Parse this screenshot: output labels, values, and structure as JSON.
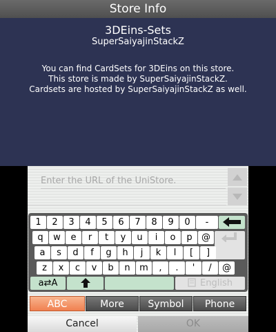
{
  "top": {
    "title": "Store Info",
    "store_name": "3DEins-Sets",
    "store_author": "SuperSaiyajinStackZ",
    "description": [
      "You can find CardSets for 3DEins on this store.",
      "This store is made by SuperSaiyajinStackZ.",
      "Cardsets are hosted by SuperSaiyajinStackZ as well."
    ]
  },
  "url_field": {
    "placeholder": "Enter the URL of the UniStore.",
    "value": ""
  },
  "keyboard": {
    "row1": [
      "1",
      "2",
      "3",
      "4",
      "5",
      "6",
      "7",
      "8",
      "9",
      "0",
      "-"
    ],
    "row2": [
      "q",
      "w",
      "e",
      "r",
      "t",
      "y",
      "u",
      "i",
      "o",
      "p",
      "@"
    ],
    "row3": [
      "a",
      "s",
      "d",
      "f",
      "g",
      "h",
      "j",
      "k",
      "l",
      "[",
      "]"
    ],
    "row4": [
      "z",
      "x",
      "c",
      "v",
      "b",
      "n",
      "m",
      ",",
      ".",
      "'",
      "/",
      "@"
    ],
    "backspace_icon": "left-arrow-icon",
    "enter_icon": "enter-arrow-icon",
    "shift_label": "a⇄A",
    "shift_up_icon": "up-arrow-icon",
    "language_label": "English",
    "language_icon": "document-icon"
  },
  "mode_tabs": {
    "abc": "ABC",
    "more": "More",
    "symbol": "Symbol",
    "phone": "Phone",
    "active": "ABC",
    "active_color": "#f08050"
  },
  "buttons": {
    "cancel": "Cancel",
    "ok": "OK"
  }
}
